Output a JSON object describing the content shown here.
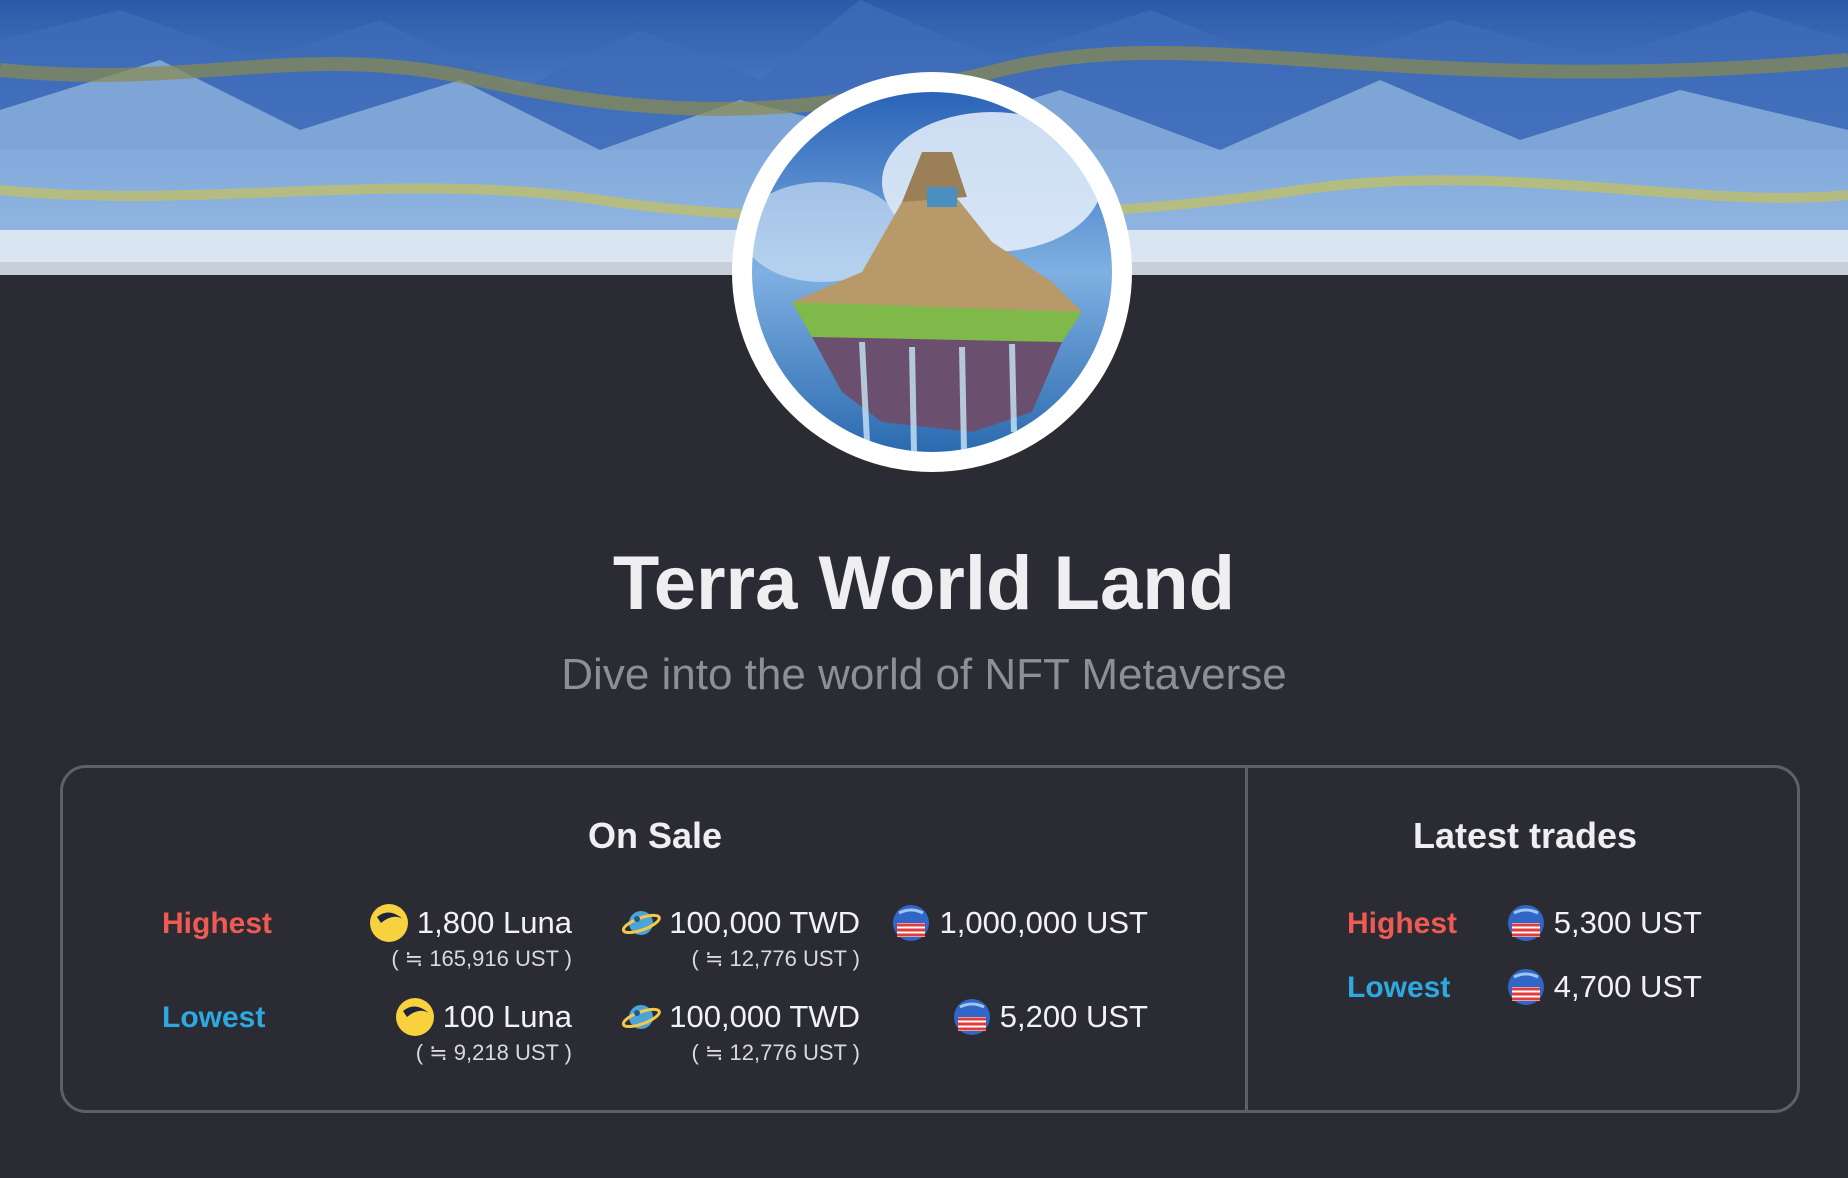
{
  "collection": {
    "title": "Terra World Land",
    "subtitle": "Dive into the world of NFT Metaverse"
  },
  "on_sale": {
    "title": "On Sale",
    "highest": {
      "label": "Highest",
      "luna": {
        "value": "1,800 Luna",
        "approx": "( ≒ 165,916 UST )"
      },
      "twd": {
        "value": "100,000 TWD",
        "approx": "( ≒ 12,776 UST )"
      },
      "ust": {
        "value": "1,000,000 UST"
      }
    },
    "lowest": {
      "label": "Lowest",
      "luna": {
        "value": "100 Luna",
        "approx": "( ≒ 9,218 UST )"
      },
      "twd": {
        "value": "100,000 TWD",
        "approx": "( ≒ 12,776 UST )"
      },
      "ust": {
        "value": "5,200 UST"
      }
    }
  },
  "latest_trades": {
    "title": "Latest trades",
    "highest": {
      "label": "Highest",
      "value": "5,300 UST"
    },
    "lowest": {
      "label": "Lowest",
      "value": "4,700 UST"
    }
  },
  "icons": {
    "luna": "luna-coin-icon",
    "twd": "planet-twd-icon",
    "ust": "ust-flag-globe-icon"
  },
  "colors": {
    "background": "#2b2b33",
    "highest": "#ef5a52",
    "lowest": "#2ea8e0",
    "border": "#5f5f67"
  }
}
